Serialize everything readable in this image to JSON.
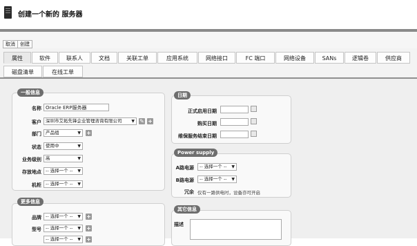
{
  "page": {
    "title": "创建一个新的 服务器"
  },
  "toolbar": {
    "cancel_label": "取消",
    "create_label": "创建"
  },
  "tabs": [
    {
      "label": "属性"
    },
    {
      "label": "软件"
    },
    {
      "label": "联系人"
    },
    {
      "label": "文档"
    },
    {
      "label": "关联工单"
    },
    {
      "label": "应用系统"
    },
    {
      "label": "网络接口"
    },
    {
      "label": "FC 端口"
    },
    {
      "label": "网络设备"
    },
    {
      "label": "SANs"
    },
    {
      "label": "逻辑卷"
    },
    {
      "label": "供应商"
    },
    {
      "label": "磁盘清单"
    },
    {
      "label": "在线工单"
    }
  ],
  "general": {
    "legend": "一般信息",
    "name_label": "名称",
    "name_value": "Oracle ERP服务器",
    "customer_label": "客户",
    "customer_value": "深圳市艾拓先锋企业管理咨询有限公司",
    "dept_label": "部门",
    "dept_value": "产品组",
    "status_label": "状态",
    "status_value": "使用中",
    "level_label": "业务级别",
    "level_value": "高",
    "location_label": "存放地点",
    "location_value": "-- 选择一个 --",
    "rack_label": "机柜",
    "rack_value": "-- 选择一个 --"
  },
  "more": {
    "legend": "更多信息",
    "brand_label": "品牌",
    "brand_value": "-- 选择一个 --",
    "model_label": "型号",
    "model_value": "-- 选择一个 --",
    "os_value": "-- 选择一个 --"
  },
  "dates": {
    "legend": "日期",
    "start_label": "正式启用日期",
    "purchase_label": "购买日期",
    "warranty_label": "维保服务结束日期"
  },
  "power": {
    "legend": "Power supply",
    "a_label": "A路电源",
    "a_value": "-- 选择一个 --",
    "b_label": "B路电源",
    "b_value": "-- 选择一个 --",
    "redundancy_label": "冗余",
    "redundancy_hint": "仅有一路供电时，设备亦可开启"
  },
  "other": {
    "legend": "其它信息",
    "desc_label": "描述"
  },
  "icons": {
    "plus": "+",
    "arrow": "▼"
  }
}
